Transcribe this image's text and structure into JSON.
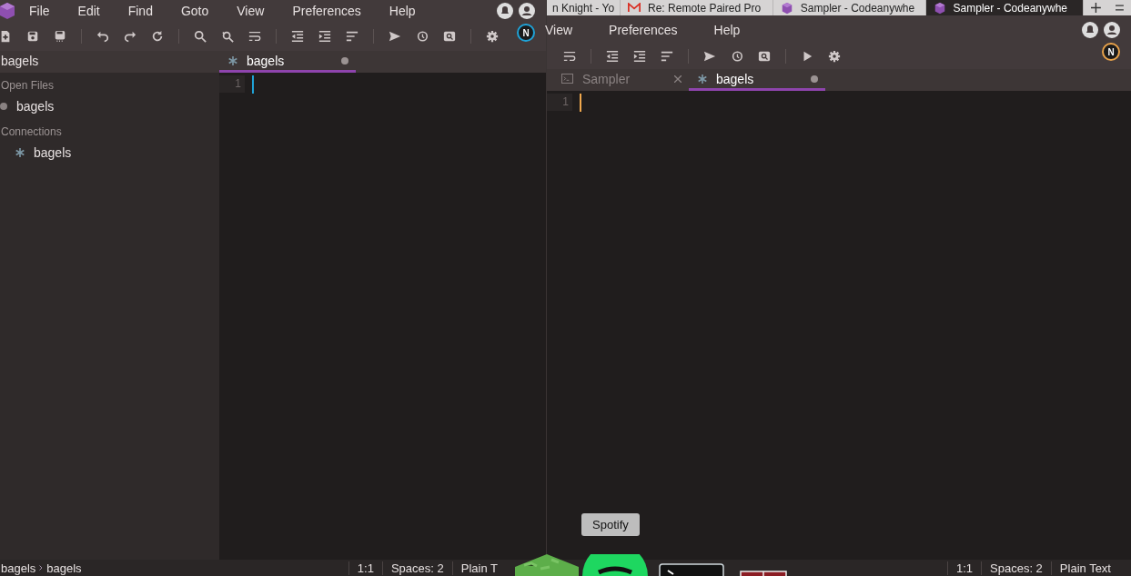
{
  "left_window": {
    "menu": [
      "File",
      "Edit",
      "Find",
      "Goto",
      "View",
      "Preferences",
      "Help"
    ],
    "user_initial": "N",
    "sidebar": {
      "title": "bagels",
      "sections": [
        {
          "heading": "Open Files",
          "items": [
            {
              "label": "bagels",
              "kind": "file"
            }
          ]
        },
        {
          "heading": "Connections",
          "items": [
            {
              "label": "bagels",
              "kind": "connection"
            }
          ]
        }
      ]
    },
    "tabs": [
      {
        "label": "bagels",
        "kind": "connection",
        "selected": true,
        "modified": true
      }
    ],
    "line_numbers": [
      "1"
    ],
    "status_bar": {
      "breadcrumb": [
        "bagels",
        "bagels"
      ],
      "position": "1:1",
      "indent": "Spaces: 2",
      "mode": "Plain T"
    }
  },
  "browser_tabs": [
    {
      "title": "n Knight - Yo",
      "kind": "page",
      "selected": false
    },
    {
      "title": "Re: Remote Paired Pro",
      "kind": "mail",
      "selected": false
    },
    {
      "title": "Sampler - Codeanywhe",
      "kind": "app",
      "selected": false
    },
    {
      "title": "Sampler - Codeanywhe",
      "kind": "app",
      "selected": true
    }
  ],
  "right_window": {
    "menu": [
      "View",
      "Preferences",
      "Help"
    ],
    "user_initial": "N",
    "tabs": [
      {
        "label": "Sampler",
        "kind": "terminal",
        "selected": false,
        "modified": false
      },
      {
        "label": "bagels",
        "kind": "connection",
        "selected": true,
        "modified": true
      }
    ],
    "line_numbers": [
      "1"
    ],
    "status_bar": {
      "position": "1:1",
      "indent": "Spaces: 2",
      "mode": "Plain Text"
    }
  },
  "dock": {
    "tooltip": "Spotify"
  }
}
